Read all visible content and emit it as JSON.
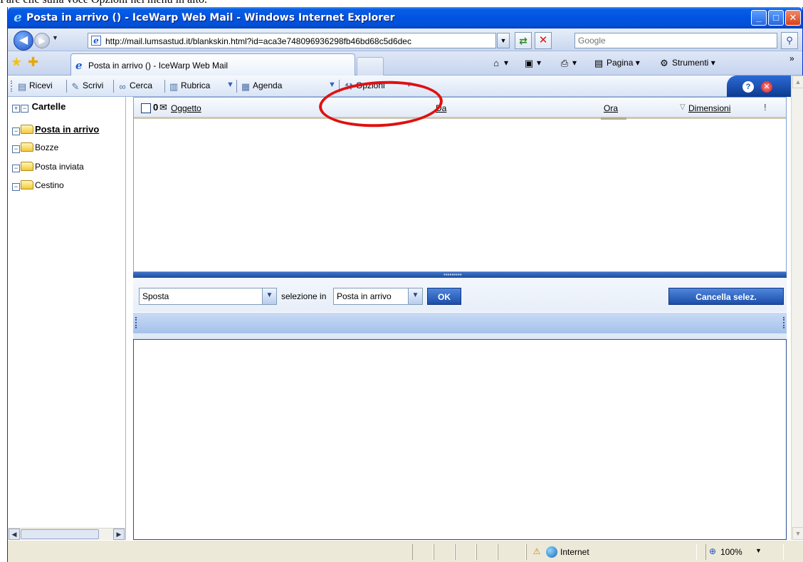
{
  "document_caption": "Fare clic sulla voce Opzioni nel menu in alto.",
  "window": {
    "title": "Posta in arrivo () - IceWarp Web Mail - Windows Internet Explorer",
    "minimize": "_",
    "maximize": "□",
    "close": "✕"
  },
  "address_bar": {
    "url": "http://mail.lumsastud.it/blankskin.html?id=aca3e748096936298fb46bd68c5d6dec",
    "search_placeholder": "Google"
  },
  "tabs": {
    "active_label": "Posta in arrivo () - IceWarp Web Mail"
  },
  "command_bar": {
    "page_label": "Pagina",
    "tools_label": "Strumenti",
    "overflow": "»"
  },
  "toolbar": {
    "receive": "Ricevi",
    "compose": "Scrivi",
    "search": "Cerca",
    "addressbook": "Rubrica",
    "calendar": "Agenda",
    "options": "Opzioni"
  },
  "folders": {
    "header": "Cartelle",
    "items": [
      {
        "label": "Posta in arrivo",
        "active": true
      },
      {
        "label": "Bozze",
        "active": false
      },
      {
        "label": "Posta inviata",
        "active": false
      },
      {
        "label": "Cestino",
        "active": false
      }
    ]
  },
  "message_list": {
    "columns": {
      "subject": "Oggetto",
      "from": "Da",
      "time": "Ora",
      "size": "Dimensioni",
      "priority": "!"
    }
  },
  "actions": {
    "move_selected": "Sposta",
    "selection_in_label": "selezione in",
    "target_folder": "Posta in arrivo",
    "ok_label": "OK",
    "delete_selection": "Cancella selez."
  },
  "status_bar": {
    "zone": "Internet",
    "zoom": "100%"
  },
  "colors": {
    "titlebar": "#0054e3",
    "accent_blue": "#1c4ea9",
    "annotation_red": "#e01010"
  }
}
